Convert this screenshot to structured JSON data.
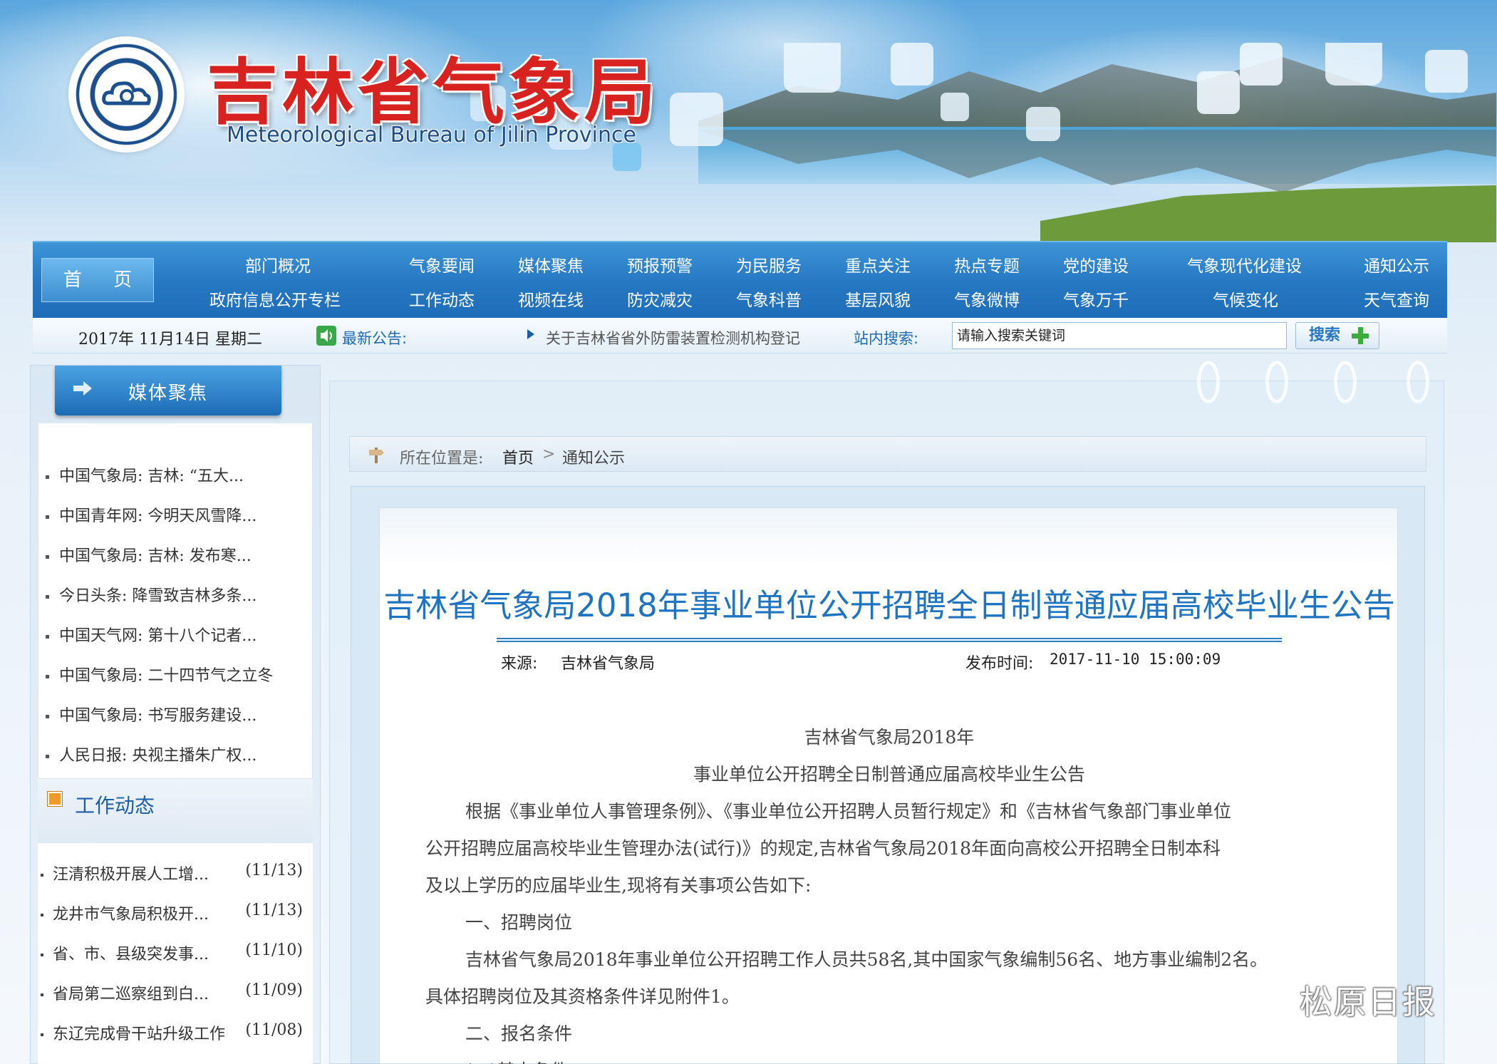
{
  "header": {
    "title_cn": "吉林省气象局",
    "title_en": "Meteorological Bureau of Jilin Province"
  },
  "nav": {
    "home_label": "首 页",
    "items": [
      "部门概况",
      "气象要闻",
      "媒体聚焦",
      "预报预警",
      "为民服务",
      "重点关注",
      "热点专题",
      "党的建设",
      "气象现代化建设",
      "通知公示",
      "政府信息公开专栏",
      "工作动态",
      "视频在线",
      "防灾减灾",
      "气象科普",
      "基层风貌",
      "气象微博",
      "气象万千",
      "气候变化",
      "天气查询"
    ]
  },
  "infobar": {
    "date": "2017年 11月14日 星期二",
    "notice_label": "最新公告:",
    "notice_text": "关于吉林省省外防雷装置检测机构登记",
    "search_label": "站内搜索:",
    "search_value": "请输入搜索关键词",
    "search_button": "搜索"
  },
  "sidebar": {
    "media_title": "媒体聚焦",
    "media_items": [
      "中国气象局: 吉林: “五大...",
      "中国青年网: 今明天风雪降...",
      "中国气象局: 吉林: 发布寒...",
      "今日头条: 降雪致吉林多条...",
      "中国天气网: 第十八个记者...",
      "中国气象局: 二十四节气之立冬",
      "中国气象局: 书写服务建设...",
      "人民日报: 央视主播朱广权..."
    ],
    "work_title": "工作动态",
    "work_items": [
      {
        "title": "汪清积极开展人工增...",
        "date": "(11/13)"
      },
      {
        "title": "龙井市气象局积极开...",
        "date": "(11/13)"
      },
      {
        "title": "省、市、县级突发事...",
        "date": "(11/10)"
      },
      {
        "title": "省局第二巡察组到白...",
        "date": "(11/09)"
      },
      {
        "title": "东辽完成骨干站升级工作",
        "date": "(11/08)"
      }
    ]
  },
  "breadcrumb": {
    "label": "所在位置是:",
    "home": "首页",
    "separator": ">",
    "current": "通知公示"
  },
  "article": {
    "title": "吉林省气象局2018年事业单位公开招聘全日制普通应届高校毕业生公告",
    "source_label": "来源:",
    "source_value": "吉林省气象局",
    "time_label": "发布时间:",
    "time_value": "2017-11-10 15:00:09",
    "heading_1": "吉林省气象局2018年",
    "heading_2": "事业单位公开招聘全日制普通应届高校毕业生公告",
    "para_1a": "根据《事业单位人事管理条例》、《事业单位公开招聘人员暂行规定》和《吉林省气象部门事业单位",
    "para_1b": "公开招聘应届高校毕业生管理办法(试行)》的规定,吉林省气象局2018年面向高校公开招聘全日制本科",
    "para_1c": "及以上学历的应届毕业生,现将有关事项公告如下:",
    "section_1": "一、招聘岗位",
    "para_2a": "吉林省气象局2018年事业单位公开招聘工作人员共58名,其中国家气象编制56名、地方事业编制2名。",
    "para_2b": "具体招聘岗位及其资格条件详见附件1。",
    "section_2": "二、报名条件",
    "section_2_1": "(一)基本条件"
  },
  "watermark": {
    "text": "松原日报"
  },
  "colors": {
    "title_red": "#d8221f",
    "nav_blue": "#2779c4",
    "article_title_blue": "#1f74c1"
  }
}
